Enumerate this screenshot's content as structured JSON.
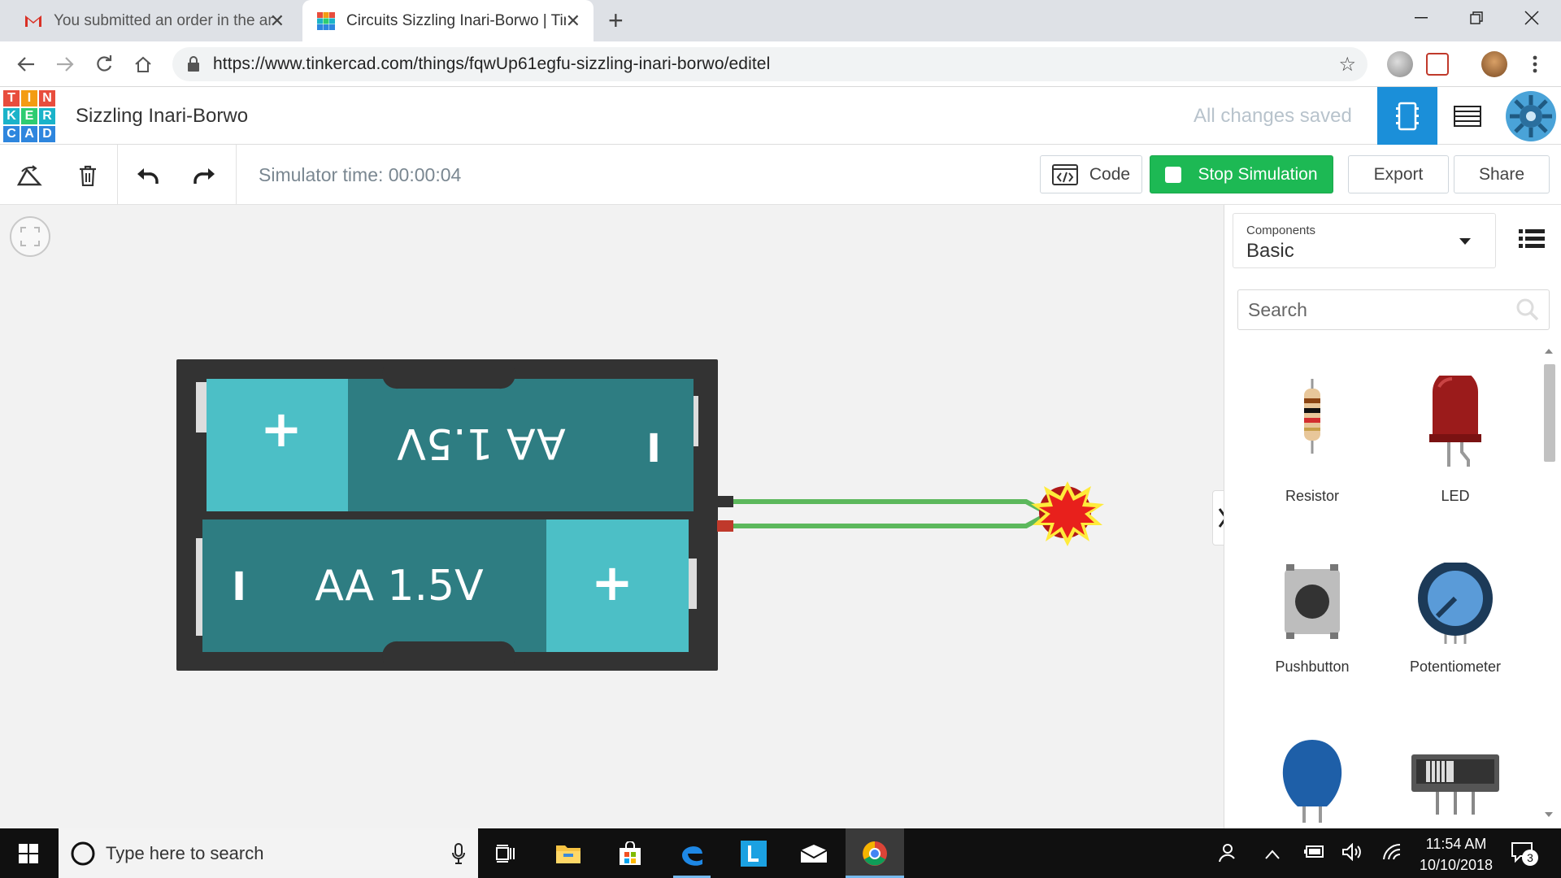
{
  "browser": {
    "tabs": [
      {
        "title": "You submitted an order in the amount",
        "active": false,
        "icon": "gmail-icon"
      },
      {
        "title": "Circuits Sizzling Inari-Borwo | Tinkercad",
        "active": true,
        "icon": "tinkercad-icon"
      }
    ],
    "url": "https://www.tinkercad.com/things/fqwUp61egfu-sizzling-inari-borwo/editel"
  },
  "app": {
    "logo_letters": [
      "T",
      "I",
      "N",
      "K",
      "E",
      "R",
      "C",
      "A",
      "D"
    ],
    "project_title": "Sizzling Inari-Borwo",
    "save_status": "All changes saved"
  },
  "toolbar": {
    "simulator_time": "Simulator time: 00:00:04",
    "code_label": "Code",
    "stop_label": "Stop Simulation",
    "export_label": "Export",
    "share_label": "Share"
  },
  "canvas": {
    "battery_top_label": "AA 1.5V",
    "battery_bottom_label": "AA 1.5V",
    "plus_sign": "+",
    "minus_sign": "I"
  },
  "panel": {
    "dropdown_label": "Components",
    "dropdown_value": "Basic",
    "search_placeholder": "Search",
    "components": [
      {
        "name": "Resistor"
      },
      {
        "name": "LED"
      },
      {
        "name": "Pushbutton"
      },
      {
        "name": "Potentiometer"
      }
    ]
  },
  "taskbar": {
    "search_text": "Type here to search",
    "time": "11:54 AM",
    "date": "10/10/2018",
    "notification_count": "3"
  },
  "colors": {
    "tinkercad_blue": "#1b8fd9",
    "stop_green": "#1db954",
    "battery_teal": "#2e7d82",
    "battery_light": "#4cbfc6"
  }
}
